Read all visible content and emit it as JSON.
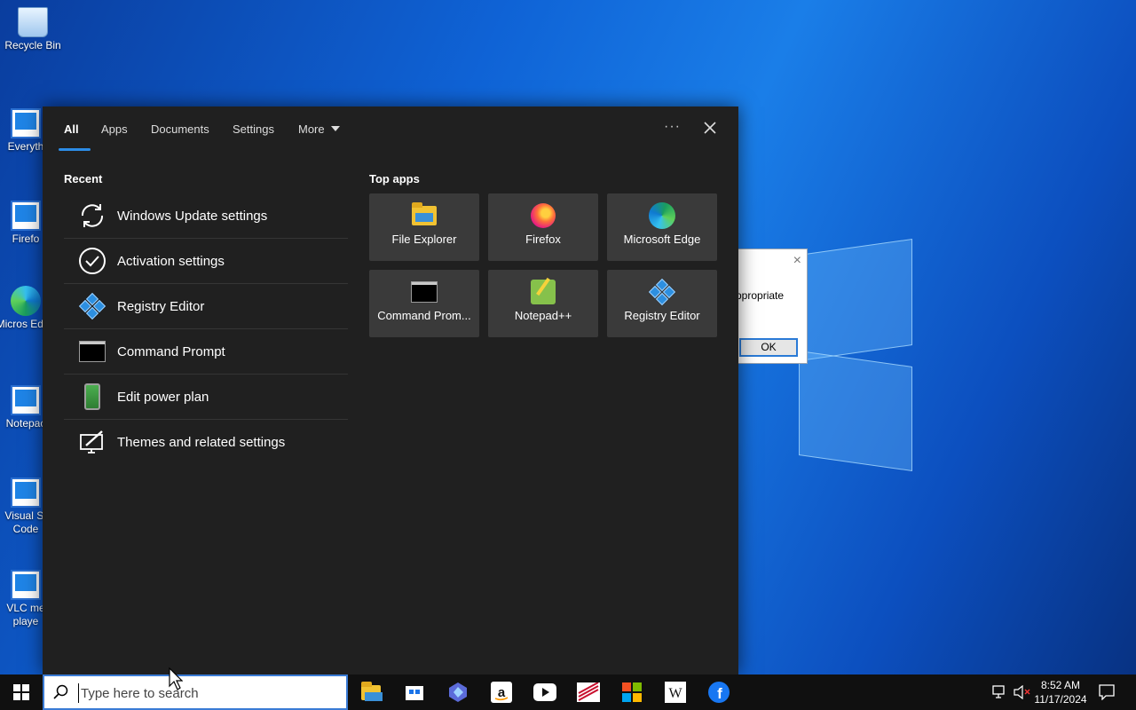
{
  "desktop": {
    "icons": [
      {
        "label": "Recycle Bin",
        "icon": "recycle-bin-icon"
      },
      {
        "label": "Everyth",
        "icon": "shortcut-icon"
      },
      {
        "label": "Firefo",
        "icon": "shortcut-icon"
      },
      {
        "label": "Micros Edge",
        "icon": "edge-icon"
      },
      {
        "label": "Notepac",
        "icon": "shortcut-icon"
      },
      {
        "label": "Visual St Code",
        "icon": "shortcut-icon"
      },
      {
        "label": "VLC me playe",
        "icon": "shortcut-icon"
      }
    ]
  },
  "dialog": {
    "message": "ppropriate",
    "ok_label": "OK",
    "close_glyph": "×"
  },
  "search_panel": {
    "tabs": [
      {
        "label": "All",
        "active": true
      },
      {
        "label": "Apps",
        "active": false
      },
      {
        "label": "Documents",
        "active": false
      },
      {
        "label": "Settings",
        "active": false
      },
      {
        "label": "More",
        "active": false
      }
    ],
    "ellipsis": "···",
    "recent_title": "Recent",
    "recent": [
      {
        "label": "Windows Update settings",
        "icon": "refresh-icon"
      },
      {
        "label": "Activation settings",
        "icon": "checkmark-circle-icon"
      },
      {
        "label": "Registry Editor",
        "icon": "registry-editor-icon"
      },
      {
        "label": "Command Prompt",
        "icon": "command-prompt-icon"
      },
      {
        "label": "Edit power plan",
        "icon": "battery-icon"
      },
      {
        "label": "Themes and related settings",
        "icon": "themes-brush-icon"
      }
    ],
    "top_apps_title": "Top apps",
    "top_apps": [
      {
        "label": "File Explorer",
        "icon": "file-explorer-icon"
      },
      {
        "label": "Firefox",
        "icon": "firefox-icon"
      },
      {
        "label": "Microsoft Edge",
        "icon": "edge-icon"
      },
      {
        "label": "Command Prom...",
        "icon": "command-prompt-icon"
      },
      {
        "label": "Notepad++",
        "icon": "notepadpp-icon"
      },
      {
        "label": "Registry Editor",
        "icon": "registry-editor-icon"
      }
    ]
  },
  "taskbar": {
    "search_placeholder": "Type here to search",
    "apps": [
      "file-explorer-icon",
      "store-icon",
      "copilot-icon",
      "amazon-icon",
      "youtube-icon",
      "bank-icon",
      "microsoft-icon",
      "wikipedia-icon",
      "facebook-icon"
    ],
    "time": "8:52 AM",
    "date": "11/17/2024"
  },
  "colors": {
    "accent": "#2c8ce6",
    "panel_bg": "#202020",
    "tile_bg": "#3a3a3a",
    "taskbar_bg": "#101010"
  }
}
